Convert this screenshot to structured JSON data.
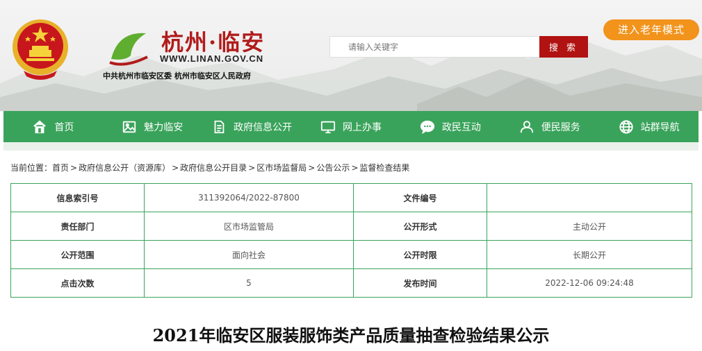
{
  "header": {
    "site_title": "杭州·临安",
    "site_url": "WWW.LINAN.GOV.CN",
    "org_line": "中共杭州市临安区委 杭州市临安区人民政府",
    "search_placeholder": "请输入关键字",
    "search_button": "搜 索",
    "elder_mode": "进入老年模式"
  },
  "nav": {
    "items": [
      {
        "label": "首页",
        "icon": "home-icon"
      },
      {
        "label": "魅力临安",
        "icon": "image-icon"
      },
      {
        "label": "政府信息公开",
        "icon": "document-icon"
      },
      {
        "label": "网上办事",
        "icon": "monitor-icon"
      },
      {
        "label": "政民互动",
        "icon": "chat-icon"
      },
      {
        "label": "便民服务",
        "icon": "user-icon"
      },
      {
        "label": "站群导航",
        "icon": "globe-icon"
      }
    ]
  },
  "breadcrumb": {
    "prefix": "当前位置：",
    "items": [
      "首页",
      "政府信息公开（资源库）",
      "政府信息公开目录",
      "区市场监督局",
      "公告公示",
      "监督检查结果"
    ],
    "separator": ">"
  },
  "info": {
    "rows": [
      {
        "l1": "信息索引号",
        "v1": "311392064/2022-87800",
        "l2": "文件编号",
        "v2": ""
      },
      {
        "l1": "责任部门",
        "v1": "区市场监管局",
        "l2": "公开形式",
        "v2": "主动公开"
      },
      {
        "l1": "公开范围",
        "v1": "面向社会",
        "l2": "公开时限",
        "v2": "长期公开"
      },
      {
        "l1": "点击次数",
        "v1": "5",
        "l2": "发布时间",
        "v2": "2022-12-06 09:24:48"
      }
    ]
  },
  "article": {
    "title": "2021年临安区服装服饰类产品质量抽查检验结果公示"
  },
  "colors": {
    "nav_green": "#3aa35b",
    "search_red": "#b11212",
    "elder_orange": "#f2931c",
    "title_red": "#b11b1b"
  }
}
